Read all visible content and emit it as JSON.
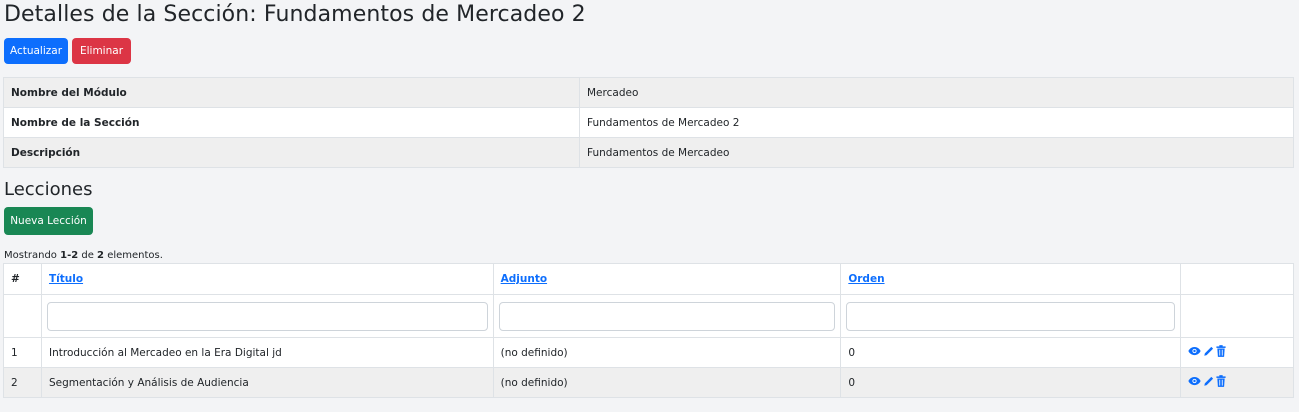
{
  "page": {
    "title": "Detalles de la Sección: Fundamentos de Mercadeo 2"
  },
  "buttons": {
    "update": "Actualizar",
    "delete": "Eliminar",
    "new_lesson": "Nueva Lección"
  },
  "details": [
    {
      "label": "Nombre del Módulo",
      "value": "Mercadeo"
    },
    {
      "label": "Nombre de la Sección",
      "value": "Fundamentos de Mercadeo 2"
    },
    {
      "label": "Descripción",
      "value": "Fundamentos de Mercadeo"
    }
  ],
  "lessons": {
    "heading": "Lecciones",
    "summary": {
      "prefix": "Mostrando ",
      "range": "1-2",
      "middle": " de ",
      "total": "2",
      "suffix": " elementos."
    },
    "columns": {
      "num": "#",
      "title": "Título",
      "attachment": "Adjunto",
      "order": "Orden"
    },
    "rows": [
      {
        "num": "1",
        "title": "Introducción al Mercadeo en la Era Digital jd",
        "attachment": "(no definido)",
        "order": "0"
      },
      {
        "num": "2",
        "title": "Segmentación y Análisis de Audiencia",
        "attachment": "(no definido)",
        "order": "0"
      }
    ],
    "icons": [
      "eye-icon",
      "pencil-icon",
      "trash-icon"
    ]
  },
  "colors": {
    "primary": "#0d6efd",
    "danger": "#dc3545",
    "success": "#198754"
  }
}
